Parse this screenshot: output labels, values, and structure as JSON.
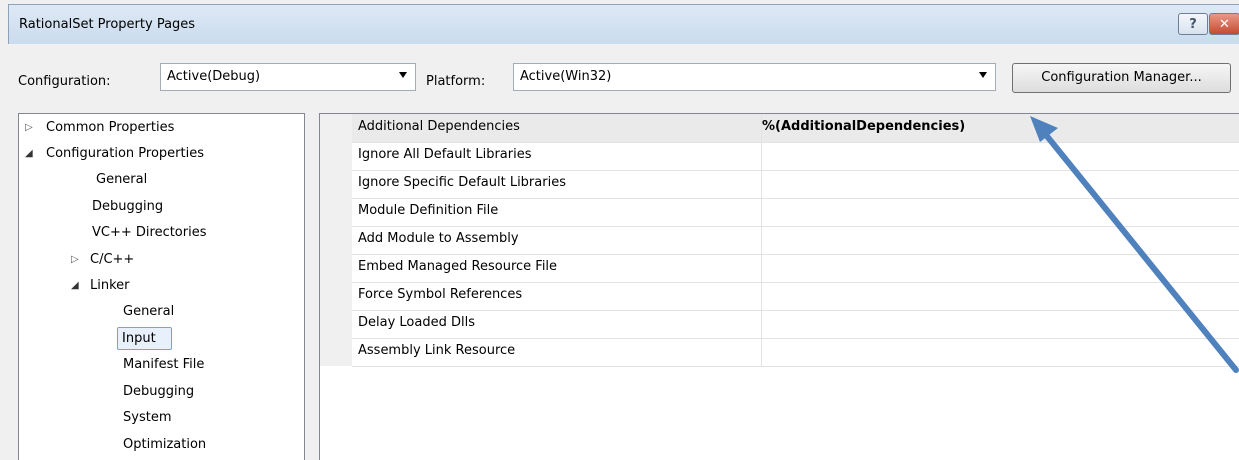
{
  "window": {
    "title": "RationalSet Property Pages",
    "help_glyph": "?",
    "close_glyph": "✕"
  },
  "toolbar": {
    "configuration_label": "Configuration:",
    "configuration_value": "Active(Debug)",
    "platform_label": "Platform:",
    "platform_value": "Active(Win32)",
    "config_manager_label": "Configuration Manager..."
  },
  "tree": {
    "items": [
      {
        "label": "Common Properties",
        "state": "collapsed"
      },
      {
        "label": "Configuration Properties",
        "state": "expanded"
      },
      {
        "label": "General"
      },
      {
        "label": "Debugging"
      },
      {
        "label": "VC++ Directories"
      },
      {
        "label": "C/C++",
        "state": "collapsed"
      },
      {
        "label": "Linker",
        "state": "expanded"
      },
      {
        "label": "General"
      },
      {
        "label": "Input",
        "selected": true
      },
      {
        "label": "Manifest File"
      },
      {
        "label": "Debugging"
      },
      {
        "label": "System"
      },
      {
        "label": "Optimization"
      }
    ],
    "collapsed_glyph": "▷",
    "expanded_glyph": "◢"
  },
  "properties": {
    "rows": [
      {
        "name": "Additional Dependencies",
        "value": "%(AdditionalDependencies)"
      },
      {
        "name": "Ignore All Default Libraries",
        "value": ""
      },
      {
        "name": "Ignore Specific Default Libraries",
        "value": ""
      },
      {
        "name": "Module Definition File",
        "value": ""
      },
      {
        "name": "Add Module to Assembly",
        "value": ""
      },
      {
        "name": "Embed Managed Resource File",
        "value": ""
      },
      {
        "name": "Force Symbol References",
        "value": ""
      },
      {
        "name": "Delay Loaded Dlls",
        "value": ""
      },
      {
        "name": "Assembly Link Resource",
        "value": ""
      }
    ]
  },
  "colors": {
    "annotation_arrow": "#4f81bd",
    "selection_border": "#7da2ce"
  }
}
